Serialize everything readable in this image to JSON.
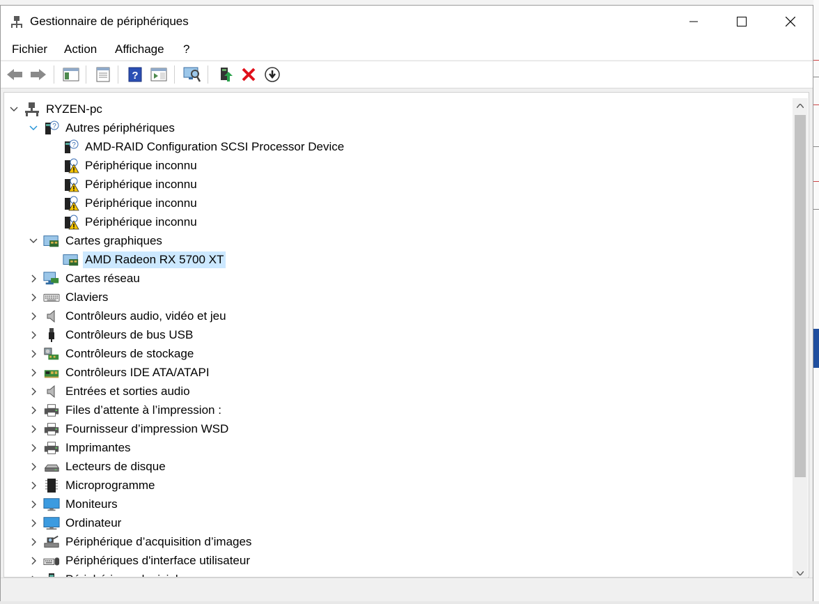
{
  "window": {
    "title": "Gestionnaire de périphériques"
  },
  "menu": [
    "Fichier",
    "Action",
    "Affichage",
    "?"
  ],
  "toolbar_icons": [
    "back-arrow-icon",
    "forward-arrow-icon",
    "show-hide-console-tree-icon",
    "properties-icon",
    "help-icon",
    "action-pane-icon",
    "scan-hardware-icon",
    "update-driver-icon",
    "uninstall-icon",
    "disable-device-icon"
  ],
  "tree": {
    "root": "RYZEN-pc",
    "categories": [
      {
        "label": "Autres périphériques",
        "expanded": true,
        "icon": "unknown-device-icon",
        "children": [
          {
            "label": "AMD-RAID Configuration SCSI Processor Device",
            "icon": "unknown-device-icon"
          },
          {
            "label": "Périphérique inconnu",
            "icon": "warning-device-icon"
          },
          {
            "label": "Périphérique inconnu",
            "icon": "warning-device-icon"
          },
          {
            "label": "Périphérique inconnu",
            "icon": "warning-device-icon"
          },
          {
            "label": "Périphérique inconnu",
            "icon": "warning-device-icon"
          }
        ]
      },
      {
        "label": "Cartes graphiques",
        "expanded": true,
        "icon": "display-adapter-icon",
        "children": [
          {
            "label": "AMD Radeon RX 5700 XT",
            "icon": "display-adapter-icon",
            "selected": true
          }
        ]
      },
      {
        "label": "Cartes réseau",
        "icon": "network-adapter-icon"
      },
      {
        "label": "Claviers",
        "icon": "keyboard-icon"
      },
      {
        "label": "Contrôleurs audio, vidéo et jeu",
        "icon": "speaker-icon"
      },
      {
        "label": "Contrôleurs de bus USB",
        "icon": "usb-icon"
      },
      {
        "label": "Contrôleurs de stockage",
        "icon": "storage-controller-icon"
      },
      {
        "label": "Contrôleurs IDE ATA/ATAPI",
        "icon": "ide-controller-icon"
      },
      {
        "label": "Entrées et sorties audio",
        "icon": "speaker-icon"
      },
      {
        "label": "Files d’attente à l’impression :",
        "icon": "printer-icon"
      },
      {
        "label": "Fournisseur d’impression WSD",
        "icon": "printer-icon"
      },
      {
        "label": "Imprimantes",
        "icon": "printer-icon"
      },
      {
        "label": "Lecteurs de disque",
        "icon": "disk-drive-icon"
      },
      {
        "label": "Microprogramme",
        "icon": "firmware-chip-icon"
      },
      {
        "label": "Moniteurs",
        "icon": "monitor-icon"
      },
      {
        "label": "Ordinateur",
        "icon": "computer-icon"
      },
      {
        "label": "Périphérique d’acquisition d’images",
        "icon": "camera-scanner-icon"
      },
      {
        "label": "Périphériques d'interface utilisateur",
        "icon": "hid-icon"
      },
      {
        "label": "Périphériques logiciels",
        "icon": "software-device-icon"
      }
    ]
  }
}
